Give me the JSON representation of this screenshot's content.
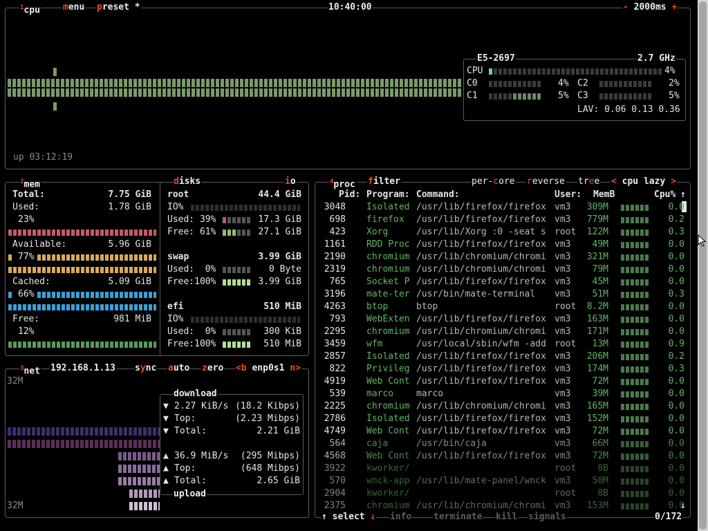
{
  "cpu_box": {
    "title_num": "1",
    "title": "cpu",
    "menu": "menu",
    "menu_key": "m",
    "preset": "preset",
    "preset_key": "p",
    "preset_star": "*",
    "clock": "10:40:00",
    "interval_minus": "-",
    "interval": "2000ms",
    "interval_plus": "+",
    "uptime": "up 03:12:19",
    "model": "E5-2697",
    "freq": "2.7 GHz",
    "total_label": "CPU",
    "total_pct": "4%",
    "cores": [
      {
        "name": "C0",
        "pct": "4%"
      },
      {
        "name": "C2",
        "pct": "2%"
      },
      {
        "name": "C1",
        "pct": "5%"
      },
      {
        "name": "C3",
        "pct": "5%"
      }
    ],
    "lav_label": "LAV:",
    "lav": "0.06 0.13 0.36"
  },
  "mem_box": {
    "title_num": "2",
    "title": "mem",
    "total_label": "Total:",
    "total": "7.75 GiB",
    "used_label": "Used:",
    "used": "1.78 GiB",
    "used_pct": "23%",
    "available_label": "Available:",
    "available": "5.96 GiB",
    "available_pct": "77%",
    "cached_label": "Cached:",
    "cached": "5.09 GiB",
    "cached_pct": "66%",
    "free_label": "Free:",
    "free": "981 MiB",
    "free_pct": "12%"
  },
  "disks_box": {
    "title": "disks",
    "title_key": "d",
    "io_label": "io",
    "io_key": "i",
    "disks": [
      {
        "name": "root",
        "size": "44.4 GiB",
        "io": "IO%",
        "used_label": "Used: 39%",
        "used": "17.3 GiB",
        "free_label": "Free: 61%",
        "free": "27.1 GiB"
      },
      {
        "name": "swap",
        "size": "3.99 GiB",
        "used_label": "Used:  0%",
        "used": "0 Byte",
        "free_label": "Free:100%",
        "free": "3.99 GiB"
      },
      {
        "name": "efi",
        "size": "510 MiB",
        "io": "IO%",
        "used_label": "Used:  0%",
        "used": "300 KiB",
        "free_label": "Free:100%",
        "free": "510 MiB"
      }
    ]
  },
  "net_box": {
    "title_num": "3",
    "title": "net",
    "ip": "192.168.1.13",
    "sync": "sync",
    "sync_key": "y",
    "auto": "auto",
    "auto_key": "a",
    "zero": "zero",
    "zero_key": "z",
    "iface_prev": "<b",
    "iface": "enp0s1",
    "iface_next": "n>",
    "scale_top": "32M",
    "scale_bottom": "32M",
    "download_title": "download",
    "upload_title": "upload",
    "dl_rate": "2.27 KiB/s",
    "dl_rate_bits": "(18.2 Kibps)",
    "dl_top_label": "Top:",
    "dl_top": "(2.23 Mibps)",
    "dl_total_label": "Total:",
    "dl_total": "2.21 GiB",
    "ul_rate": "36.9 MiB/s",
    "ul_rate_bits": "(295 Mibps)",
    "ul_top_label": "Top:",
    "ul_top": "(648 Mibps)",
    "ul_total_label": "Total:",
    "ul_total": "2.65 GiB",
    "down_arrow": "▼",
    "up_arrow": "▲"
  },
  "proc_box": {
    "title_num": "4",
    "title": "proc",
    "filter": "filter",
    "filter_key": "f",
    "per_core": "per-core",
    "per_core_key": "c",
    "reverse": "reverse",
    "reverse_key": "r",
    "tree": "tree",
    "tree_key": "e",
    "sort_prev": "<",
    "sort": "cpu lazy",
    "sort_next": ">",
    "headers": {
      "pid": "Pid:",
      "program": "Program:",
      "command": "Command:",
      "user": "User:",
      "mem": "MemB",
      "cpu": "Cpu%"
    },
    "footer_up": "↑",
    "footer_select": "select",
    "footer_down": "↓",
    "footer_info": "info",
    "footer_terminate": "terminate",
    "footer_kill": "kill",
    "footer_signals": "signals",
    "count": "0/172",
    "rows": [
      {
        "pid": "3048",
        "program": "Isolated",
        "command": "/usr/lib/firefox/firefox",
        "user": "vm3",
        "mem": "309M",
        "cpu": "0.0"
      },
      {
        "pid": "698",
        "program": "firefox",
        "command": "/usr/lib/firefox/firefox",
        "user": "vm3",
        "mem": "779M",
        "cpu": "0.2"
      },
      {
        "pid": "423",
        "program": "Xorg",
        "command": "/usr/lib/Xorg :0 -seat s",
        "user": "root",
        "mem": "122M",
        "cpu": "0.3"
      },
      {
        "pid": "1161",
        "program": "RDD Proc",
        "command": "/usr/lib/firefox/firefox",
        "user": "vm3",
        "mem": "49M",
        "cpu": "0.0"
      },
      {
        "pid": "2190",
        "program": "chromium",
        "command": "/usr/lib/chromium/chromi",
        "user": "vm3",
        "mem": "321M",
        "cpu": "0.0"
      },
      {
        "pid": "2319",
        "program": "chromium",
        "command": "/usr/lib/chromium/chromi",
        "user": "vm3",
        "mem": "79M",
        "cpu": "0.0"
      },
      {
        "pid": "765",
        "program": "Socket P",
        "command": "/usr/lib/firefox/firefox",
        "user": "vm3",
        "mem": "45M",
        "cpu": "0.0"
      },
      {
        "pid": "3196",
        "program": "mate-ter",
        "command": "/usr/bin/mate-terminal",
        "user": "vm3",
        "mem": "51M",
        "cpu": "0.3"
      },
      {
        "pid": "4263",
        "program": "btop",
        "command": "btop",
        "user": "root",
        "mem": "8.2M",
        "cpu": "0.0"
      },
      {
        "pid": "793",
        "program": "WebExten",
        "command": "/usr/lib/firefox/firefox",
        "user": "vm3",
        "mem": "163M",
        "cpu": "0.0"
      },
      {
        "pid": "2295",
        "program": "chromium",
        "command": "/usr/lib/chromium/chromi",
        "user": "vm3",
        "mem": "171M",
        "cpu": "0.0"
      },
      {
        "pid": "3459",
        "program": "wfm",
        "command": "/usr/local/sbin/wfm -add",
        "user": "root",
        "mem": "13M",
        "cpu": "0.9"
      },
      {
        "pid": "2857",
        "program": "Isolated",
        "command": "/usr/lib/firefox/firefox",
        "user": "vm3",
        "mem": "206M",
        "cpu": "0.2"
      },
      {
        "pid": "822",
        "program": "Privileg",
        "command": "/usr/lib/firefox/firefox",
        "user": "vm3",
        "mem": "174M",
        "cpu": "0.3"
      },
      {
        "pid": "4919",
        "program": "Web Cont",
        "command": "/usr/lib/firefox/firefox",
        "user": "vm3",
        "mem": "72M",
        "cpu": "0.0"
      },
      {
        "pid": "539",
        "program": "marco",
        "command": "marco",
        "user": "vm3",
        "mem": "39M",
        "cpu": "0.0"
      },
      {
        "pid": "2225",
        "program": "chromium",
        "command": "/usr/lib/chromium/chromi",
        "user": "vm3",
        "mem": "165M",
        "cpu": "0.0"
      },
      {
        "pid": "2786",
        "program": "Isolated",
        "command": "/usr/lib/firefox/firefox",
        "user": "vm3",
        "mem": "152M",
        "cpu": "0.0"
      },
      {
        "pid": "4749",
        "program": "Web Cont",
        "command": "/usr/lib/firefox/firefox",
        "user": "vm3",
        "mem": "72M",
        "cpu": "0.0"
      },
      {
        "pid": "564",
        "program": "caja",
        "command": "/usr/bin/caja",
        "user": "vm3",
        "mem": "66M",
        "cpu": "0.0"
      },
      {
        "pid": "4568",
        "program": "Web Cont",
        "command": "/usr/lib/firefox/firefox",
        "user": "vm3",
        "mem": "72M",
        "cpu": "0.0"
      },
      {
        "pid": "3922",
        "program": "kworker/",
        "command": "",
        "user": "root",
        "mem": "0B",
        "cpu": "0.0"
      },
      {
        "pid": "570",
        "program": "wnck-app",
        "command": "/usr/lib/mate-panel/wnck",
        "user": "vm3",
        "mem": "50M",
        "cpu": "0.0"
      },
      {
        "pid": "2904",
        "program": "kworker/",
        "command": "",
        "user": "root",
        "mem": "0B",
        "cpu": "0.0"
      },
      {
        "pid": "2375",
        "program": "chromium",
        "command": "/usr/lib/chromium/chromi",
        "user": "vm3",
        "mem": "153M",
        "cpu": "0.0"
      }
    ]
  },
  "colors": {
    "border": "#5c5c5c",
    "accent": "#ee4b2b",
    "cpu_graph": "#7a9a6a",
    "used": "#c65a6a",
    "available": "#d9a85a",
    "cached": "#3aa0d8",
    "free": "#5a9a5a",
    "net_download": "#4a3a6a",
    "net_upload": "#8a6a9a"
  }
}
